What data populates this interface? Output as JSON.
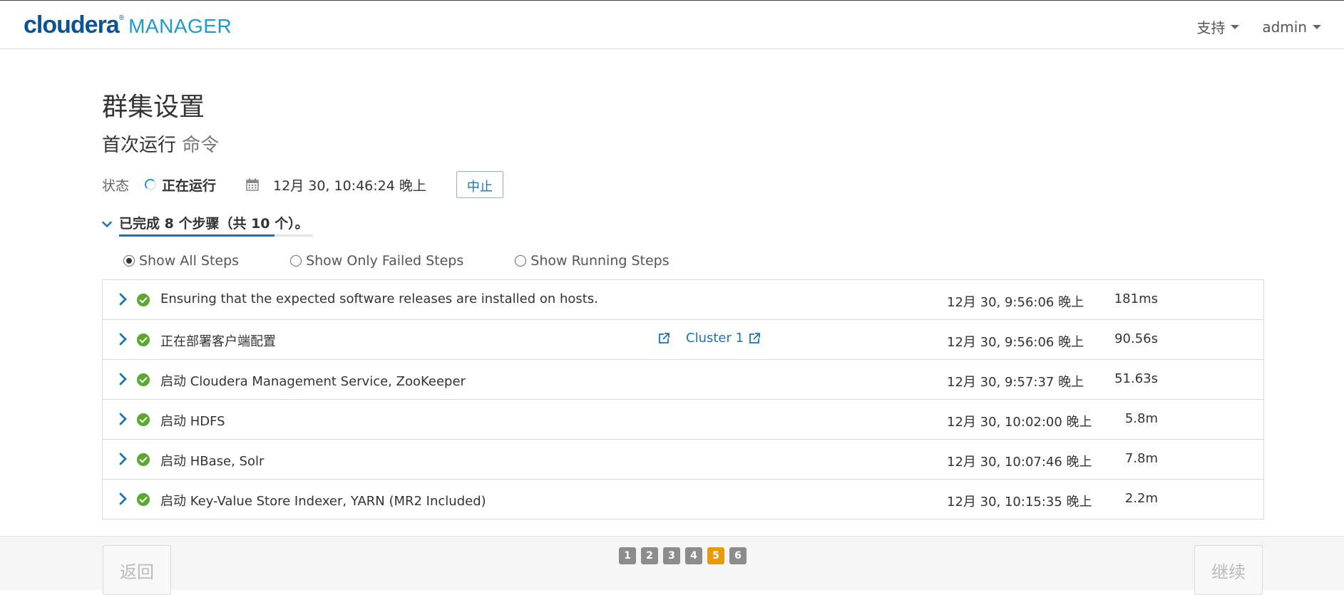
{
  "header": {
    "brand": "cloudera",
    "brand_reg": "®",
    "product": "MANAGER",
    "support_label": "支持",
    "user_label": "admin"
  },
  "page": {
    "title": "群集设置",
    "command_title_strong": "首次运行",
    "command_title_muted": "命令",
    "status_label": "状态",
    "status_value": "正在运行",
    "start_time": "12月 30, 10:46:24 晚上",
    "abort_label": "中止",
    "progress_text": "已完成 8 个步骤（共 10 个）。",
    "progress_completed": 8,
    "progress_total": 10
  },
  "filters": [
    {
      "label": "Show All Steps",
      "checked": true
    },
    {
      "label": "Show Only Failed Steps",
      "checked": false
    },
    {
      "label": "Show Running Steps",
      "checked": false
    }
  ],
  "steps": [
    {
      "name": "Ensuring that the expected software releases are installed on hosts.",
      "time": "12月 30, 9:56:06 晚上",
      "duration": "181ms",
      "status": "success"
    },
    {
      "name": "正在部署客户端配置",
      "time": "12月 30, 9:56:06 晚上",
      "duration": "90.56s",
      "status": "success",
      "link": "Cluster 1"
    },
    {
      "name": "启动 Cloudera Management Service, ZooKeeper",
      "time": "12月 30, 9:57:37 晚上",
      "duration": "51.63s",
      "status": "success"
    },
    {
      "name": "启动 HDFS",
      "time": "12月 30, 10:02:00 晚上",
      "duration": "5.8m",
      "status": "success"
    },
    {
      "name": "启动 HBase, Solr",
      "time": "12月 30, 10:07:46 晚上",
      "duration": "7.8m",
      "status": "success"
    },
    {
      "name": "启动 Key-Value Store Indexer, YARN (MR2 Included)",
      "time": "12月 30, 10:15:35 晚上",
      "duration": "2.2m",
      "status": "success"
    }
  ],
  "footer": {
    "back_label": "返回",
    "continue_label": "继续",
    "pages": [
      "1",
      "2",
      "3",
      "4",
      "5",
      "6"
    ],
    "active_page": "5"
  },
  "colors": {
    "brand": "#0b5394",
    "accent": "#1a73b5",
    "success": "#5aa830",
    "active_page": "#e89a0c"
  }
}
